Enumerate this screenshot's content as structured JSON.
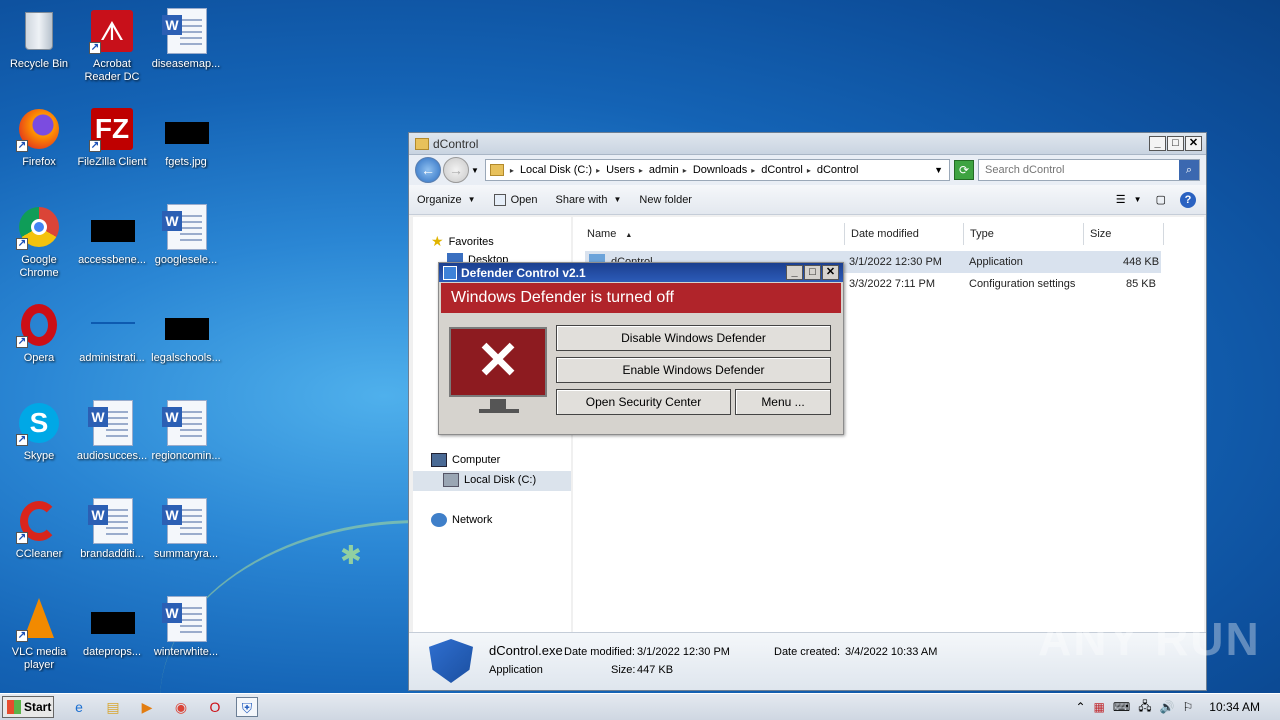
{
  "desktop": {
    "icons": [
      {
        "label": "Recycle Bin"
      },
      {
        "label": "Acrobat\nReader DC"
      },
      {
        "label": "diseasemap..."
      },
      {
        "label": "Firefox"
      },
      {
        "label": "FileZilla Client"
      },
      {
        "label": "fgets.jpg"
      },
      {
        "label": "Google\nChrome"
      },
      {
        "label": "accessbene..."
      },
      {
        "label": "googlesele..."
      },
      {
        "label": "Opera"
      },
      {
        "label": "administrati..."
      },
      {
        "label": "legalschools..."
      },
      {
        "label": "Skype"
      },
      {
        "label": "audiosucces..."
      },
      {
        "label": "regioncomin..."
      },
      {
        "label": "CCleaner"
      },
      {
        "label": "brandadditi..."
      },
      {
        "label": "summaryra..."
      },
      {
        "label": "VLC media\nplayer"
      },
      {
        "label": "dateprops..."
      },
      {
        "label": "winterwhite..."
      }
    ]
  },
  "explorer": {
    "title": "dControl",
    "breadcrumb": [
      "Local Disk (C:)",
      "Users",
      "admin",
      "Downloads",
      "dControl",
      "dControl"
    ],
    "search_placeholder": "Search dControl",
    "toolbar": {
      "organize": "Organize",
      "open": "Open",
      "share_with": "Share with",
      "new_folder": "New folder"
    },
    "nav": {
      "favorites": "Favorites",
      "desktop": "Desktop",
      "computer": "Computer",
      "local_disk": "Local Disk (C:)",
      "network": "Network"
    },
    "columns": {
      "name": "Name",
      "date_modified": "Date modified",
      "type": "Type",
      "size": "Size"
    },
    "files": [
      {
        "name": "dControl",
        "date": "3/1/2022 12:30 PM",
        "type": "Application",
        "size": "448 KB"
      },
      {
        "name": "dControl",
        "date": "3/3/2022 7:11 PM",
        "type": "Configuration settings",
        "size": "85 KB"
      }
    ],
    "details": {
      "filename": "dControl.exe",
      "filetype": "Application",
      "date_modified_label": "Date modified:",
      "date_modified": "3/1/2022 12:30 PM",
      "size_label": "Size:",
      "size": "447 KB",
      "date_created_label": "Date created:",
      "date_created": "3/4/2022 10:33 AM"
    }
  },
  "defender": {
    "title": "Defender Control v2.1",
    "status": "Windows Defender is turned off",
    "disable_label": "Disable Windows Defender",
    "enable_label": "Enable Windows Defender",
    "security_center_label": "Open Security Center",
    "menu_label": "Menu ...",
    "status_color": "#b0242a"
  },
  "taskbar": {
    "start_label": "Start",
    "clock": "10:34 AM"
  },
  "watermark": "ANY RUN"
}
